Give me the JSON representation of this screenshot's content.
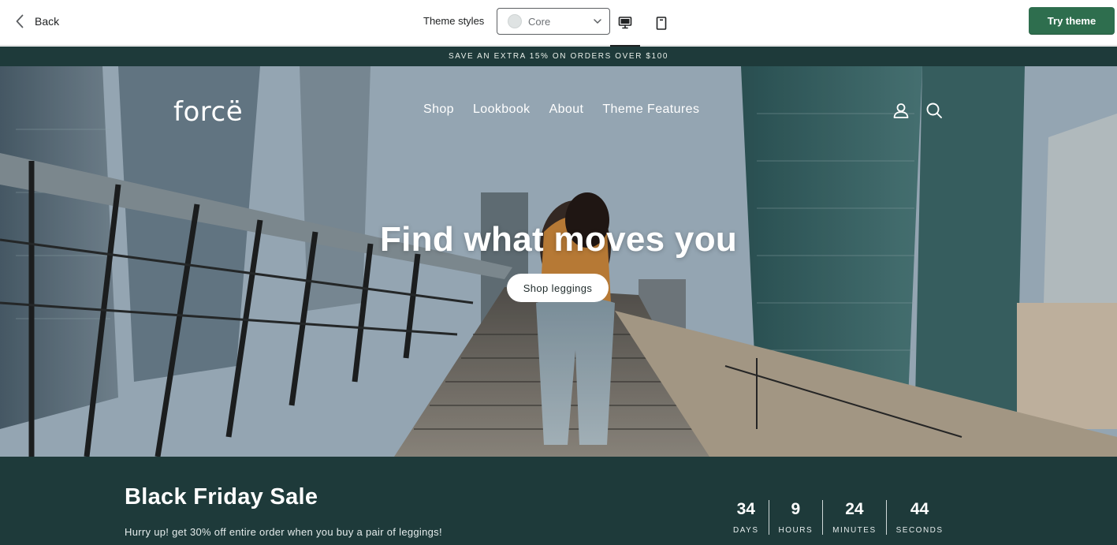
{
  "editor": {
    "back_label": "Back",
    "theme_styles_label": "Theme styles",
    "theme_style_value": "Core",
    "try_theme_label": "Try theme",
    "accent_color": "#2e6e4e",
    "views": [
      "desktop-icon",
      "mobile-icon"
    ],
    "active_view": "desktop"
  },
  "store": {
    "announcement": "SAVE AN EXTRA 15% ON ORDERS OVER $100",
    "logo": "forcë",
    "nav": [
      "Shop",
      "Lookbook",
      "About",
      "Theme Features"
    ],
    "header_icons": [
      "account-icon",
      "search-icon"
    ],
    "hero": {
      "title": "Find what moves you",
      "cta": "Shop leggings"
    },
    "sale": {
      "title": "Black Friday Sale",
      "subtitle": "Hurry up! get 30% off entire order when you buy a pair of leggings!",
      "countdown": [
        {
          "value": "34",
          "label": "DAYS"
        },
        {
          "value": "9",
          "label": "HOURS"
        },
        {
          "value": "24",
          "label": "MINUTES"
        },
        {
          "value": "44",
          "label": "SECONDS"
        }
      ]
    },
    "brand_color": "#1e3a3a"
  }
}
